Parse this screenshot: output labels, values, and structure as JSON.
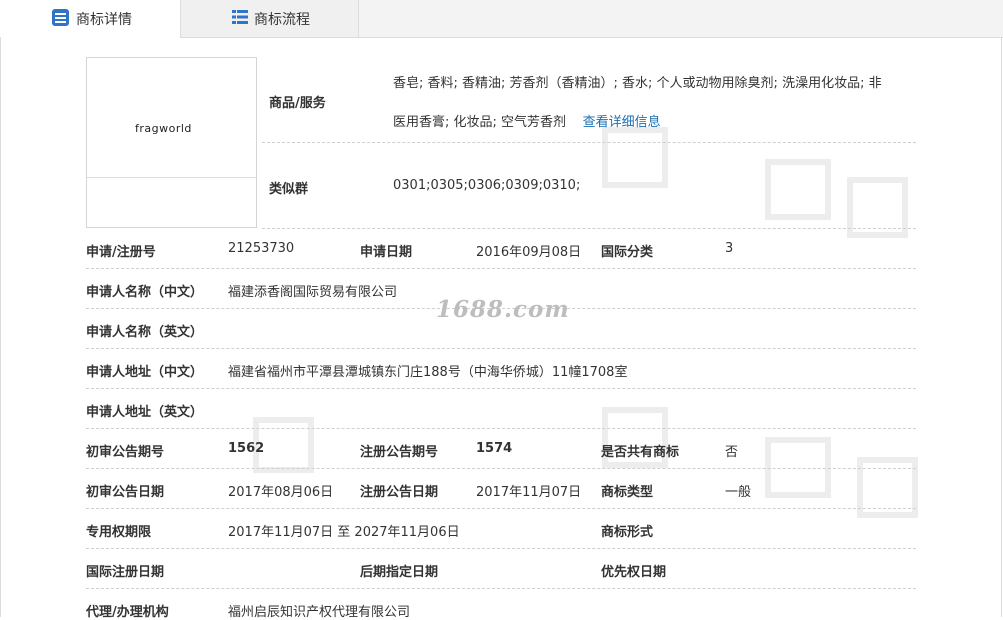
{
  "tabs": [
    {
      "label": "商标详情",
      "icon": "form-icon",
      "active": true
    },
    {
      "label": "商标流程",
      "icon": "list-icon",
      "active": false
    }
  ],
  "logo": {
    "text": "fragworld"
  },
  "goods_services": {
    "label": "商品/服务",
    "line1": "香皂; 香料; 香精油; 芳香剂（香精油）; 香水; 个人或动物用除臭剂; 洗澡用化妆品; 非",
    "line2": "医用香膏; 化妆品; 空气芳香剂",
    "more_link": "查看详细信息"
  },
  "similar_group": {
    "label": "类似群",
    "value": "0301;0305;0306;0309;0310;"
  },
  "fields": {
    "reg_no": {
      "label": "申请/注册号",
      "value": "21253730"
    },
    "apply_date": {
      "label": "申请日期",
      "value": "2016年09月08日"
    },
    "intl_class": {
      "label": "国际分类",
      "value": "3"
    },
    "applicant_cn": {
      "label": "申请人名称（中文）",
      "value": "福建添香阁国际贸易有限公司"
    },
    "applicant_en": {
      "label": "申请人名称（英文）",
      "value": ""
    },
    "address_cn": {
      "label": "申请人地址（中文）",
      "value": "福建省福州市平潭县潭城镇东门庄188号（中海华侨城）11幢1708室"
    },
    "address_en": {
      "label": "申请人地址（英文）",
      "value": ""
    },
    "prelim_pub_no": {
      "label": "初审公告期号",
      "value": "1562"
    },
    "reg_pub_no": {
      "label": "注册公告期号",
      "value": "1574"
    },
    "shared": {
      "label": "是否共有商标",
      "value": "否"
    },
    "prelim_pub_date": {
      "label": "初审公告日期",
      "value": "2017年08月06日"
    },
    "reg_pub_date": {
      "label": "注册公告日期",
      "value": "2017年11月07日"
    },
    "tm_type": {
      "label": "商标类型",
      "value": "一般"
    },
    "exclusive_period": {
      "label": "专用权期限",
      "value": "2017年11月07日 至 2027年11月06日"
    },
    "tm_form": {
      "label": "商标形式",
      "value": ""
    },
    "intl_reg_date": {
      "label": "国际注册日期",
      "value": ""
    },
    "later_designation": {
      "label": "后期指定日期",
      "value": ""
    },
    "priority_date": {
      "label": "优先权日期",
      "value": ""
    },
    "agent": {
      "label": "代理/办理机构",
      "value": "福州启辰知识产权代理有限公司"
    }
  },
  "watermark": {
    "site": "1688.com"
  }
}
